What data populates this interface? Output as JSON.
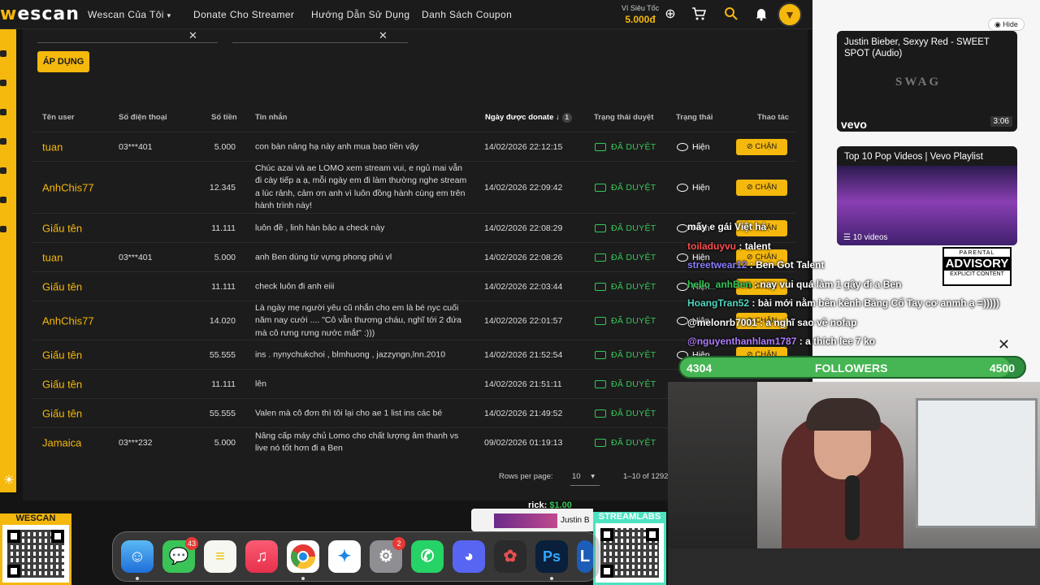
{
  "topbar": {
    "logo_a": "w",
    "logo_b": "escan",
    "nav": [
      "Wescan Của Tôi",
      "Donate Cho Streamer",
      "Hướng Dẫn Sử Dụng",
      "Danh Sách Coupon"
    ],
    "wallet_label": "Ví Siêu Tốc",
    "wallet_value": "5.000đ"
  },
  "filters": {
    "apply_label": "ÁP DỤNG"
  },
  "table": {
    "headers": {
      "user": "Tên user",
      "phone": "Số điện thoại",
      "amount": "Số tiền",
      "message": "Tin nhắn",
      "date": "Ngày được donate",
      "sort_count": "1",
      "review": "Trạng thái duyệt",
      "status": "Trạng thái",
      "action": "Thao tác"
    },
    "rows": [
      {
        "user": "tuan",
        "phone": "03***401",
        "amount": "5.000",
        "message": "con bàn nâng hạ này anh mua bao tiền vậy",
        "date": "14/02/2026 22:12:15",
        "review": "ĐÃ DUYỆT",
        "status": "Hiện",
        "action": "CHẶN"
      },
      {
        "user": "AnhChis77",
        "phone": "",
        "amount": "12.345",
        "message": "Chúc azai và ae LOMO xem stream vui, e ngủ mai vẫn đi cày tiếp a ạ, mỗi ngày em đi làm thường nghe stream a lúc rảnh, cảm ơn anh vì luôn đồng hành cùng em trên hành trình này!",
        "date": "14/02/2026 22:09:42",
        "review": "ĐÃ DUYỆT",
        "status": "Hiện",
        "action": "CHẶN"
      },
      {
        "user": "Giấu tên",
        "phone": "",
        "amount": "11.111",
        "message": "luôn đề , linh hàn bảo a check này",
        "date": "14/02/2026 22:08:29",
        "review": "ĐÃ DUYỆT",
        "status": "Hiện",
        "action": "CHẶN"
      },
      {
        "user": "tuan",
        "phone": "03***401",
        "amount": "5.000",
        "message": "anh Ben dùng từ vựng phong phú vl",
        "date": "14/02/2026 22:08:26",
        "review": "ĐÃ DUYỆT",
        "status": "Hiện",
        "action": "CHẶN"
      },
      {
        "user": "Giấu tên",
        "phone": "",
        "amount": "11.111",
        "message": "check luôn đi anh eiii",
        "date": "14/02/2026 22:03:44",
        "review": "ĐÃ DUYỆT",
        "status": "Hiện",
        "action": "CHẶN"
      },
      {
        "user": "AnhChis77",
        "phone": "",
        "amount": "14.020",
        "message": "Là ngày mẹ người yêu cũ nhắn cho em là bé nyc cuối năm nay cưới .... \"Cô vẫn thương cháu, nghĩ tới 2 đứa mà cô rưng rưng nước mắt\" :)))",
        "date": "14/02/2026 22:01:57",
        "review": "ĐÃ DUYỆT",
        "status": "Hiện",
        "action": "CHẶN"
      },
      {
        "user": "Giấu tên",
        "phone": "",
        "amount": "55.555",
        "message": "ins . nynychukchoi , blmhuong , jazzyngn,lnn.2010",
        "date": "14/02/2026 21:52:54",
        "review": "ĐÃ DUYỆT",
        "status": "Hiện",
        "action": "CHẶN"
      },
      {
        "user": "Giấu tên",
        "phone": "",
        "amount": "11.111",
        "message": "lên",
        "date": "14/02/2026 21:51:11",
        "review": "ĐÃ DUYỆT",
        "status": "",
        "action": ""
      },
      {
        "user": "Giấu tên",
        "phone": "",
        "amount": "55.555",
        "message": "Valen mà cô đơn thì tôi lại cho ae 1 list ins các bé",
        "date": "14/02/2026 21:49:52",
        "review": "ĐÃ DUYỆT",
        "status": "",
        "action": ""
      },
      {
        "user": "Jamaica",
        "phone": "03***232",
        "amount": "5.000",
        "message": "Nâng cấp máy chủ Lomo cho chất lượng âm thanh vs live nó tốt hơn đi a Ben",
        "date": "09/02/2026 01:19:13",
        "review": "ĐÃ DUYỆT",
        "status": "",
        "action": ""
      }
    ],
    "pager": {
      "rows_label": "Rows per page:",
      "rows_value": "10",
      "range": "1–10 of 1292"
    }
  },
  "right_panel": {
    "hide_label": "Hide",
    "video1_title": "Justin Bieber, Sexyy Red - SWEET SPOT (Audio)",
    "video1_art": "SWAG",
    "video1_brand": "vevo",
    "video1_duration": "3:06",
    "video2_title": "Top 10 Pop Videos | Vevo Playlist",
    "video2_count": "10 videos",
    "advisory_top": "PARENTAL",
    "advisory_mid": "ADVISORY",
    "advisory_bottom": "EXPLICIT CONTENT"
  },
  "chat": [
    {
      "user": "",
      "text": "mấy e gái Việt hả",
      "color": "#ffffff"
    },
    {
      "user": "toiladuyvu",
      "text": ": talent",
      "color": "#ff4d4d"
    },
    {
      "user": "streetwear12",
      "text": ": Ben Got Talent",
      "color": "#8a7dff"
    },
    {
      "user": "hello_anhBen",
      "text": ": nay vui quá làm 1 gậy đi a Ben",
      "color": "#35c759"
    },
    {
      "user": "HoangTran52",
      "text": ": bài mới nằm bên kênh Băng Cổ Tay cơ anmh ạ =)))))",
      "color": "#4fd6c0"
    },
    {
      "user": "@melonrb7001",
      "text": ": a nghĩ sao về nofap",
      "color": "#ffffff"
    },
    {
      "user": "@nguyenthanhlam1787",
      "text": ": a thích lee 7 ko",
      "color": "#b07dff"
    }
  ],
  "followers": {
    "current": "4304",
    "label": "FOLLOWERS",
    "goal": "4500",
    "progress": 0.9564
  },
  "overlays": {
    "wescan_label": "WESCAN",
    "streamlabs_label": "STREAMLABS",
    "tip_user": "rick:",
    "tip_amount": "$1.00",
    "now_playing": "Justin B"
  },
  "dock": {
    "messages_badge": "43",
    "settings_badge": "2"
  },
  "colors": {
    "accent": "#f5b80c",
    "approved": "#35c759",
    "panel": "#1c1c1c"
  }
}
